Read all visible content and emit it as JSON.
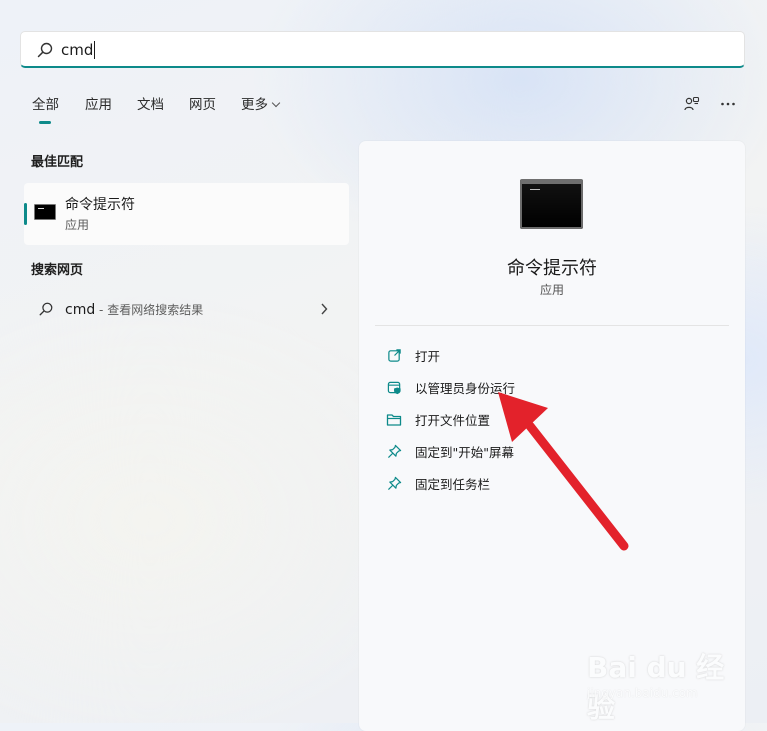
{
  "search": {
    "value": "cmd"
  },
  "tabs": [
    {
      "label": "全部"
    },
    {
      "label": "应用"
    },
    {
      "label": "文档"
    },
    {
      "label": "网页"
    },
    {
      "label": "更多"
    }
  ],
  "best_match": {
    "section_title": "最佳匹配",
    "title": "命令提示符",
    "subtitle": "应用"
  },
  "web_search": {
    "section_title": "搜索网页",
    "query": "cmd",
    "suffix": " - 查看网络搜索结果"
  },
  "detail": {
    "title": "命令提示符",
    "subtitle": "应用",
    "actions": [
      {
        "label": "打开",
        "icon": "open-external-icon"
      },
      {
        "label": "以管理员身份运行",
        "icon": "admin-shield-icon"
      },
      {
        "label": "打开文件位置",
        "icon": "folder-icon"
      },
      {
        "label": "固定到\"开始\"屏幕",
        "icon": "pin-icon"
      },
      {
        "label": "固定到任务栏",
        "icon": "pin-icon"
      }
    ]
  },
  "watermark": {
    "brand": "Bai du 经验",
    "url": "jingyan.baidu.com"
  },
  "colors": {
    "accent": "#0d8a8a",
    "arrow": "#e3222b"
  }
}
